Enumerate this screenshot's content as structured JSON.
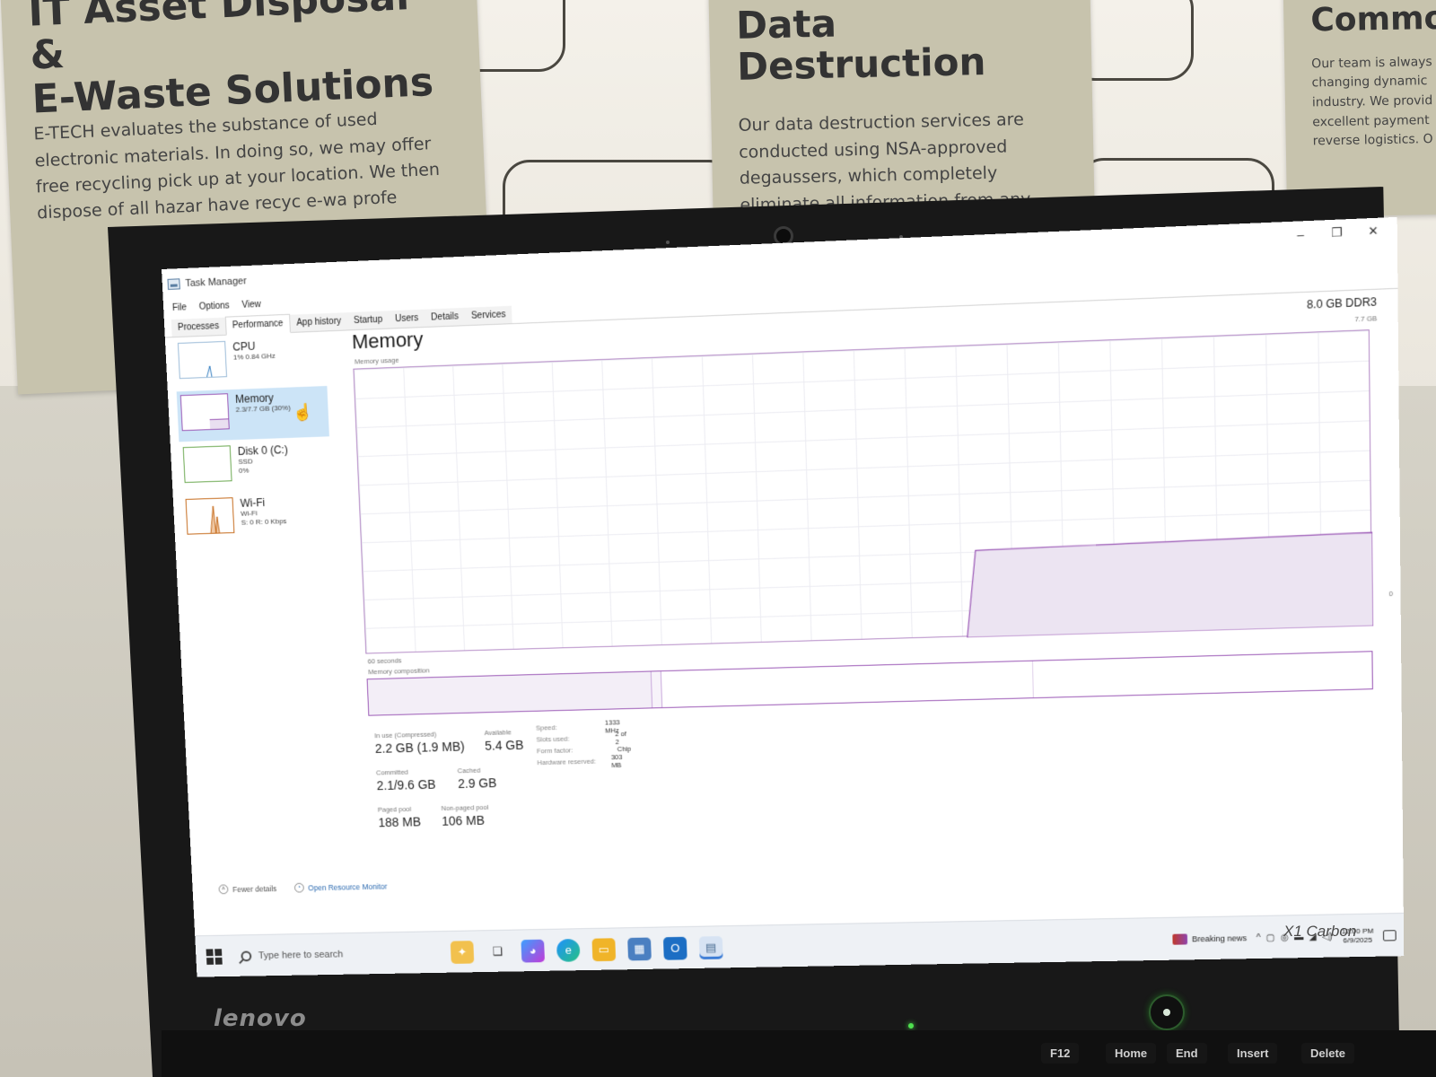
{
  "background": {
    "poster_left": {
      "title_line1": "IT Asset Disposal &",
      "title_line2": "E-Waste Solutions",
      "body": "E-TECH evaluates the substance of used electronic materials. In doing so, we may offer free recycling pick up at your location. We then dispose of all hazar have recyc e-wa profe"
    },
    "poster_center": {
      "title": "Data Destruction",
      "body": "Our data destruction services are conducted using NSA-approved degaussers, which completely eliminate all information from any electronic devices. Customer privacy is our top"
    },
    "poster_right": {
      "title": "Commod",
      "body": "Our team is always changing dynamic industry. We provid excellent payment reverse logistics. O"
    },
    "laptop_brand": "lenovo",
    "laptop_model": "X1 Carbon",
    "keys": [
      "F12",
      "Home",
      "End",
      "Insert",
      "Delete"
    ]
  },
  "window": {
    "title": "Task Manager",
    "controls": {
      "minimize": "–",
      "maximize": "❐",
      "close": "✕"
    }
  },
  "menu": [
    "File",
    "Options",
    "View"
  ],
  "tabs": [
    "Processes",
    "Performance",
    "App history",
    "Startup",
    "Users",
    "Details",
    "Services"
  ],
  "active_tab": "Performance",
  "sidebar": {
    "cpu": {
      "title": "CPU",
      "sub1": "1% 0.84 GHz"
    },
    "memory": {
      "title": "Memory",
      "sub1": "2.3/7.7 GB (30%)"
    },
    "disk": {
      "title": "Disk 0 (C:)",
      "sub1": "SSD",
      "sub2": "0%"
    },
    "wifi": {
      "title": "Wi-Fi",
      "sub1": "Wi-Fi",
      "sub2": "S: 0 R: 0 Kbps"
    }
  },
  "memory": {
    "title": "Memory",
    "type": "8.0 GB DDR3",
    "max_label": "7.7 GB",
    "usage_label": "Memory usage",
    "zero_label": "0",
    "seconds_label": "60 seconds",
    "composition_label": "Memory composition",
    "usage_fraction_recent": 0.3,
    "stats": {
      "in_use_label": "In use (Compressed)",
      "in_use_value": "2.2 GB (1.9 MB)",
      "available_label": "Available",
      "available_value": "5.4 GB",
      "committed_label": "Committed",
      "committed_value": "2.1/9.6 GB",
      "cached_label": "Cached",
      "cached_value": "2.9 GB",
      "paged_label": "Paged pool",
      "paged_value": "188 MB",
      "nonpaged_label": "Non-paged pool",
      "nonpaged_value": "106 MB"
    },
    "specs": [
      {
        "key": "Speed:",
        "value": "1333 MHz"
      },
      {
        "key": "Slots used:",
        "value": "2 of 2"
      },
      {
        "key": "Form factor:",
        "value": "Chip"
      },
      {
        "key": "Hardware reserved:",
        "value": "303 MB"
      }
    ]
  },
  "footer": {
    "fewer_details": "Fewer details",
    "open_resource_monitor": "Open Resource Monitor"
  },
  "taskbar": {
    "search_placeholder": "Type here to search",
    "news": "Breaking news",
    "time": "12:00 PM",
    "date": "6/9/2025",
    "apps": [
      "widgets-icon",
      "task-view-icon",
      "copilot-icon",
      "edge-icon",
      "file-explorer-icon",
      "store-icon",
      "outlook-icon",
      "task-manager-icon"
    ]
  },
  "colors": {
    "memory_accent": "#9b59b6",
    "selected_item": "#cce4f7",
    "disk_accent": "#6aa84f",
    "wifi_accent": "#c56a1b"
  }
}
